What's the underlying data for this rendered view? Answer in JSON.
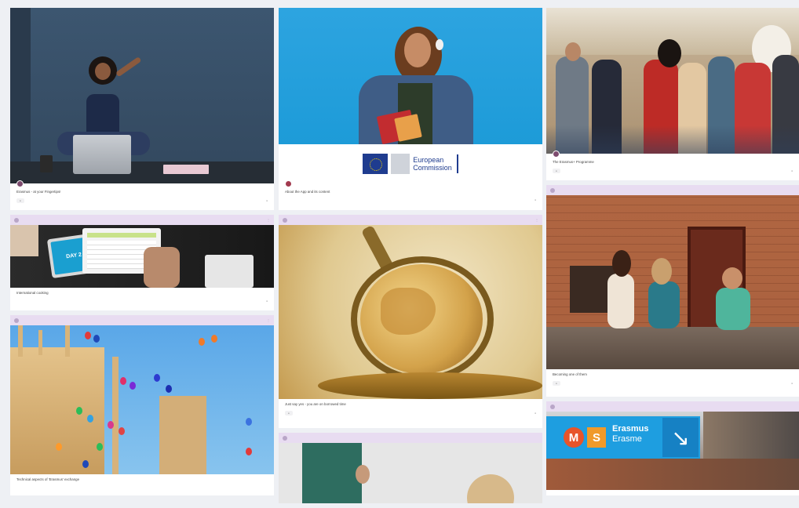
{
  "colors": {
    "accent": "#e8dcf1",
    "background": "#eef0f4",
    "card": "#ffffff"
  },
  "cards": [
    {
      "title": "Erasmus - at your Fingertips!"
    },
    {
      "title": "About the App and its content"
    },
    {
      "title": "The Erasmus+ Programme"
    },
    {
      "title": "International cooking"
    },
    {
      "title": "Just say yes - you are on borrowed time"
    },
    {
      "title": "Becoming one of them"
    },
    {
      "title": "Technical aspects of 'Erasmus' exchange"
    }
  ],
  "commission": {
    "line1": "European",
    "line2": "Commission"
  },
  "tablet_screen": "DAY 2",
  "signage": {
    "m": "M",
    "s": "S",
    "line1": "Erasmus",
    "line2": "Erasme"
  }
}
